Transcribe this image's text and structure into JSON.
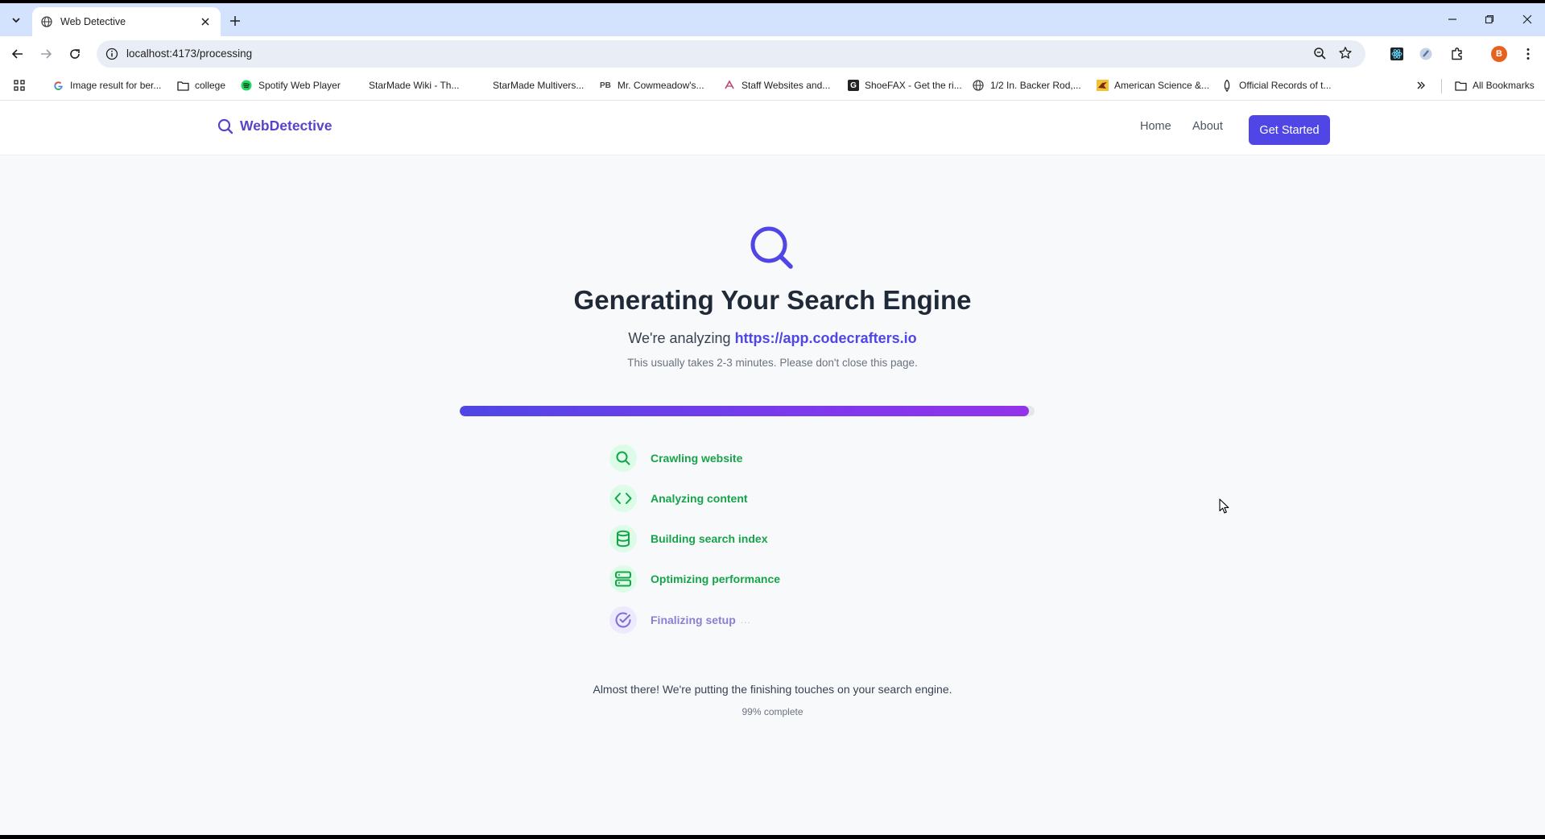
{
  "browser": {
    "tab": {
      "title": "Web Detective"
    },
    "address": {
      "url": "localhost:4173/processing"
    },
    "profile_initial": "B",
    "bookmarks": [
      {
        "label": "Image result for ber...",
        "icon": "google-icon"
      },
      {
        "label": "college",
        "icon": "folder-icon"
      },
      {
        "label": "Spotify Web Player",
        "icon": "spotify-icon"
      },
      {
        "label": "StarMade Wiki - Th...",
        "icon": ""
      },
      {
        "label": "StarMade Multivers...",
        "icon": ""
      },
      {
        "label": "Mr. Cowmeadow's...",
        "icon": "pb-icon",
        "icon_text": "PB"
      },
      {
        "label": "Staff Websites and...",
        "icon": "staff-icon"
      },
      {
        "label": "ShoeFAX - Get the ri...",
        "icon": "g-square-icon",
        "icon_text": "G"
      },
      {
        "label": "1/2 In. Backer Rod,...",
        "icon": "globe-icon"
      },
      {
        "label": "American Science &...",
        "icon": "bird-icon"
      },
      {
        "label": "Official Records of t...",
        "icon": "rocket-icon"
      }
    ],
    "all_bookmarks": "All Bookmarks"
  },
  "site": {
    "brand": "WebDetective",
    "nav": {
      "home": "Home",
      "about": "About",
      "cta": "Get Started"
    }
  },
  "main": {
    "heading": "Generating Your Search Engine",
    "analyzing_prefix": "We're analyzing",
    "analyzing_url": "https://app.codecrafters.io",
    "hint": "This usually takes 2-3 minutes. Please don't close this page.",
    "progress_percent": 99,
    "steps": [
      {
        "label": "Crawling website",
        "icon": "search-icon",
        "status": "done"
      },
      {
        "label": "Analyzing content",
        "icon": "code-icon",
        "status": "done"
      },
      {
        "label": "Building search index",
        "icon": "database-icon",
        "status": "done"
      },
      {
        "label": "Optimizing performance",
        "icon": "server-icon",
        "status": "done"
      },
      {
        "label": "Finalizing setup",
        "icon": "check-circle-icon",
        "status": "active"
      }
    ],
    "active_dots": "...",
    "status_message": "Almost there! We're putting the finishing touches on your search engine.",
    "percent_text": "99% complete"
  },
  "colors": {
    "accent": "#4f46e5",
    "done": "#16a34a",
    "active": "#8b7fd1"
  }
}
